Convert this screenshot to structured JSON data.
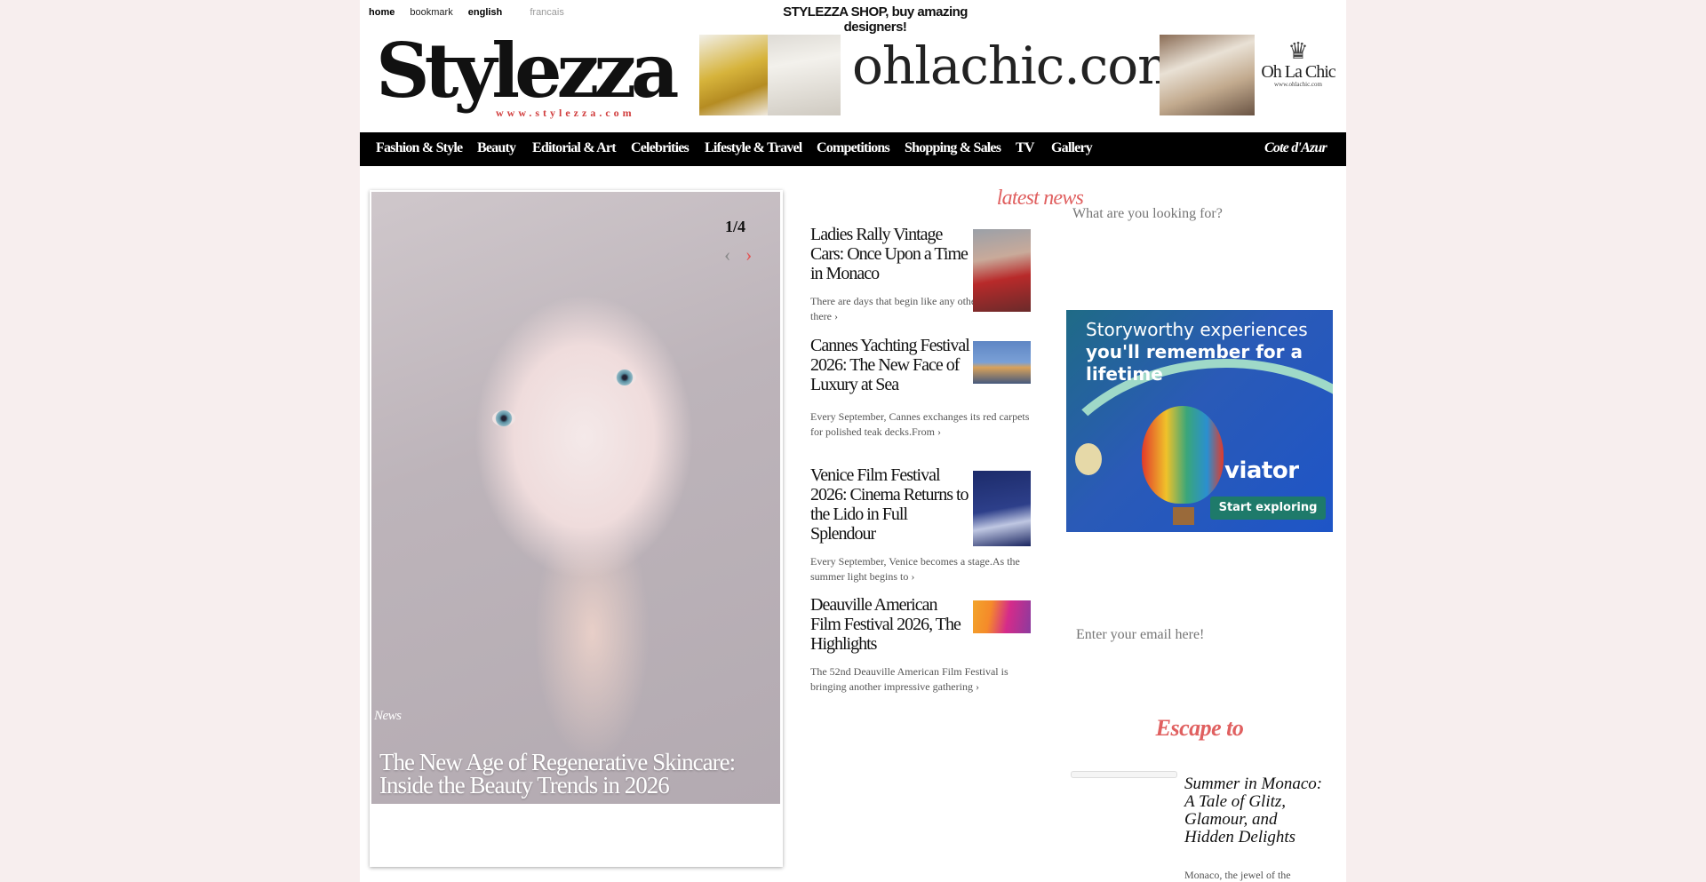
{
  "utility": {
    "home": "home",
    "bookmark": "bookmark",
    "english": "english",
    "francais": "francais"
  },
  "shop_line": "STYLEZZA SHOP, buy amazing designers!",
  "logo": {
    "word": "Stylezza",
    "url": "www.stylezza.com"
  },
  "banner": {
    "text": "ohlachic.com",
    "brand": "Oh La Chic",
    "brand_url": "www.ohlachic.com",
    "crown_icon": "crown-icon"
  },
  "nav": {
    "items": [
      "Fashion & Style",
      "Beauty",
      "Editorial & Art",
      "Celebrities",
      "Lifestyle & Travel",
      "Competitions",
      "Shopping & Sales",
      "TV",
      "Gallery"
    ],
    "right": "Cote d'Azur"
  },
  "slider": {
    "counter": "1/4",
    "category": "News",
    "title": "The New Age of Regenerative Skincare: Inside the Beauty Trends in 2026",
    "prev_icon": "chevron-left-icon",
    "next_icon": "chevron-right-icon"
  },
  "latest": {
    "heading": "latest news",
    "items": [
      {
        "title": "Ladies Rally Vintage Cars: Once Upon a Time in Monaco",
        "excerpt": "There are days that begin like any other, and then there ›"
      },
      {
        "title": "Cannes Yachting Festival 2026: The New Face of Luxury at Sea",
        "excerpt": "Every September, Cannes exchanges its red carpets for polished teak decks.From ›"
      },
      {
        "title": "Venice Film Festival 2026: Cinema Returns to the Lido in Full Splendour",
        "excerpt": "Every September, Venice becomes a stage.As the summer light begins to ›"
      },
      {
        "title": "Deauville American Film Festival 2026, The Highlights",
        "excerpt": "The 52nd Deauville American Film Festival is bringing another impressive gathering ›"
      }
    ]
  },
  "sidebar": {
    "search_placeholder": "What are you looking for?",
    "ad": {
      "headline_1": "Storyworthy experiences",
      "headline_2": "you'll remember for a lifetime",
      "brand": "viator",
      "cta": "Start exploring"
    },
    "email_placeholder": "Enter your email here!",
    "escape_heading": "Escape to",
    "escape_title": "Summer in Monaco: A Tale of Glitz, Glamour, and Hidden Delights",
    "escape_excerpt": "Monaco, the jewel of the"
  },
  "colors": {
    "accent": "#e06060",
    "nav_bg": "#000000",
    "page_bg": "#f7eeee"
  }
}
